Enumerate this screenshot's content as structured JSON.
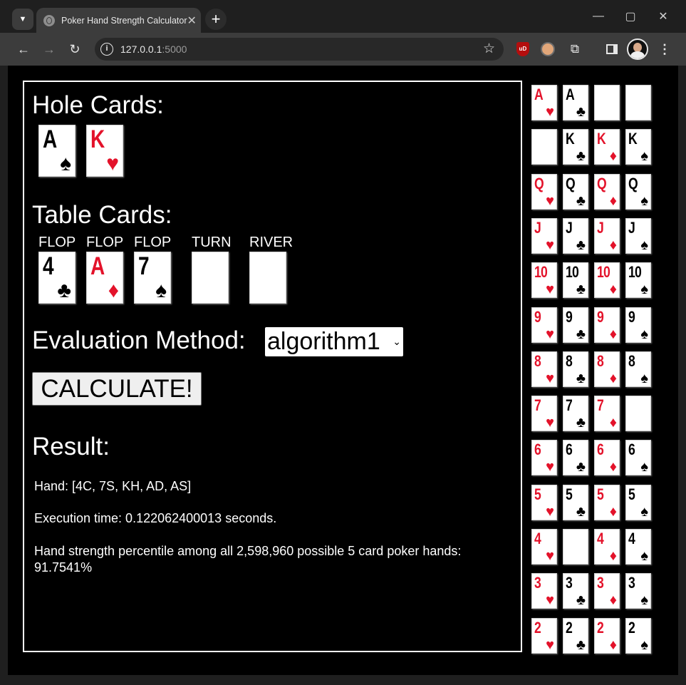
{
  "browser": {
    "tab_title": "Poker Hand Strength Calculator",
    "tab_close": "✕",
    "new_tab": "+",
    "url_host": "127.0.0.1",
    "url_port": ":5000",
    "ublock_label": "uD"
  },
  "page": {
    "hole_cards_heading": "Hole Cards:",
    "hole_cards": [
      {
        "rank": "A",
        "suit": "♠",
        "color": "#000000"
      },
      {
        "rank": "K",
        "suit": "♥",
        "color": "#e3122a"
      }
    ],
    "table_cards_heading": "Table Cards:",
    "table_slots": [
      {
        "label": "FLOP",
        "rank": "4",
        "suit": "♣",
        "color": "#000000"
      },
      {
        "label": "FLOP",
        "rank": "A",
        "suit": "♦",
        "color": "#e3122a"
      },
      {
        "label": "FLOP",
        "rank": "7",
        "suit": "♠",
        "color": "#000000"
      },
      {
        "label": "TURN",
        "rank": "",
        "suit": "",
        "color": "#000000"
      },
      {
        "label": "RIVER",
        "rank": "",
        "suit": "",
        "color": "#000000"
      }
    ],
    "eval_label": "Evaluation Method:",
    "eval_selected": "algorithm1",
    "calculate_label": "CALCULATE!",
    "result_heading": "Result:",
    "result_hand": "Hand: [4C, 7S, KH, AD, AS]",
    "result_time": "Execution time: 0.122062400013 seconds.",
    "result_percentile_line1": "Hand strength percentile among all 2,598,960 possible 5 card poker hands:",
    "result_percentile_line2": "91.7541%"
  },
  "deck": {
    "suits": [
      {
        "symbol": "♥",
        "color": "#e3122a"
      },
      {
        "symbol": "♣",
        "color": "#000000"
      },
      {
        "symbol": "♦",
        "color": "#e3122a"
      },
      {
        "symbol": "♠",
        "color": "#000000"
      }
    ],
    "ranks": [
      "A",
      "K",
      "Q",
      "J",
      "10",
      "9",
      "8",
      "7",
      "6",
      "5",
      "4",
      "3",
      "2"
    ],
    "used": [
      "A♦",
      "A♠",
      "K♥",
      "7♠",
      "4♣"
    ]
  }
}
